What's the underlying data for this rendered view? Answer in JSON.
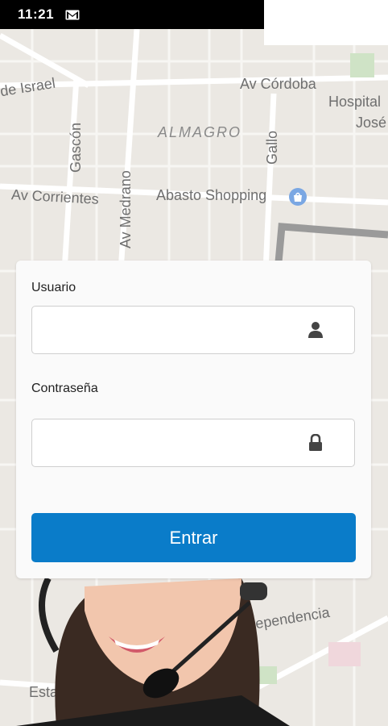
{
  "status_bar": {
    "time": "11:21",
    "notification_icon": "gmail-icon"
  },
  "map": {
    "labels": {
      "av_israel": "de Israel",
      "av_cordoba": "Av Córdoba",
      "hospital": "Hospital",
      "jose": "José",
      "almagro": "ALMAGRO",
      "gascon": "Gascón",
      "gallo": "Gallo",
      "av_medrano": "Av Medrano",
      "av_corrientes": "Av Corrientes",
      "abasto": "Abasto Shopping",
      "independencia": "Independencia",
      "estados": "Estados U"
    },
    "abasto_icon": "shopping-bag-icon"
  },
  "login": {
    "username_label": "Usuario",
    "username_value": "",
    "username_icon": "user-icon",
    "password_label": "Contraseña",
    "password_value": "",
    "password_icon": "lock-icon",
    "submit_label": "Entrar"
  },
  "colors": {
    "primary_button": "#0a7cc9",
    "status_bar": "#000000",
    "card": "#fafafa"
  }
}
